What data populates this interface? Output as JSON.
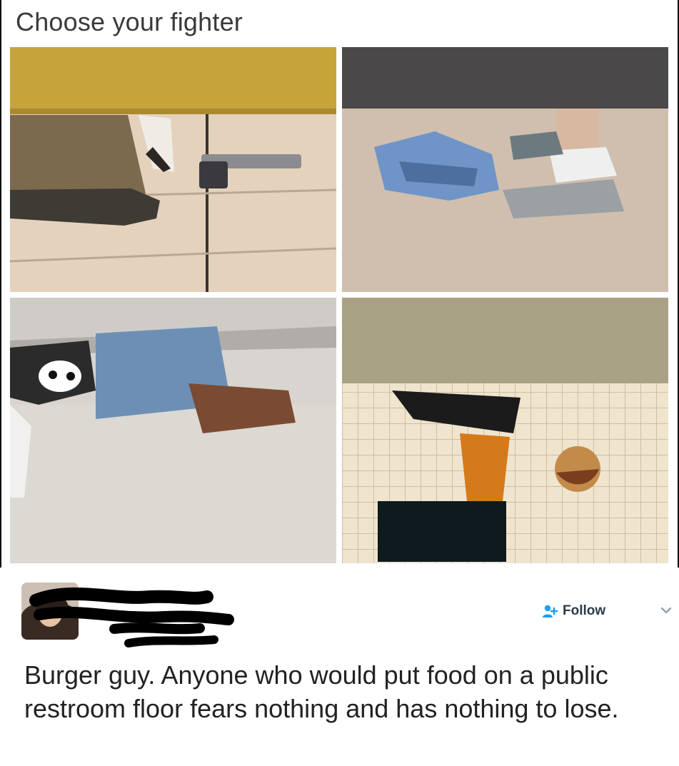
{
  "meme": {
    "caption": "Choose your fighter"
  },
  "panels": [
    {
      "name": "panel-gun-under-stall"
    },
    {
      "name": "panel-sandals-under-stall"
    },
    {
      "name": "panel-dog-under-stall"
    },
    {
      "name": "panel-burger-fries-under-stall"
    }
  ],
  "tweet": {
    "follow_label": "Follow",
    "body": "Burger guy. Anyone who would put food on a public restroom floor fears nothing and has nothing to lose."
  },
  "icons": {
    "follow": "add-person-icon",
    "menu": "chevron-down-icon"
  },
  "colors": {
    "follow_text": "#2a3a4a",
    "follow_icon": "#1da1f2",
    "redaction": "#000000"
  }
}
